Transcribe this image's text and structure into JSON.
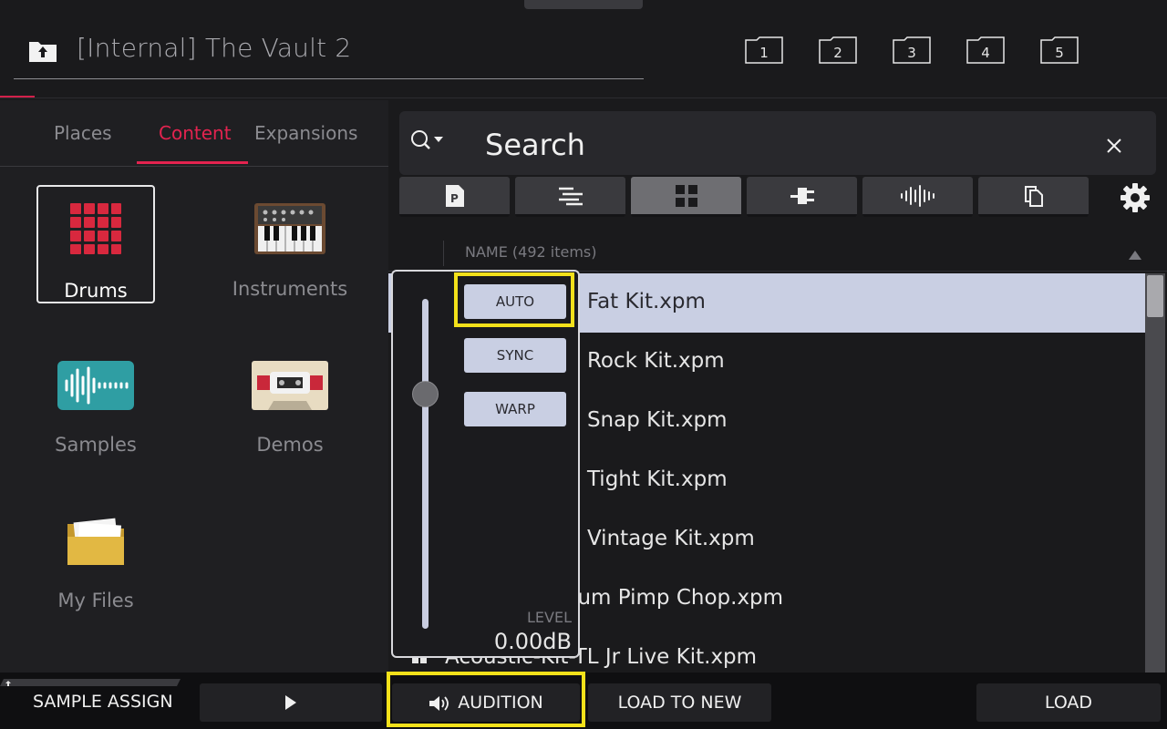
{
  "header": {
    "path_title": "[Internal] The Vault 2",
    "quick_folders": [
      "1",
      "2",
      "3",
      "4",
      "5"
    ]
  },
  "sidebar": {
    "tabs": [
      {
        "label": "Places",
        "active": false
      },
      {
        "label": "Content",
        "active": true
      },
      {
        "label": "Expansions",
        "active": false
      }
    ],
    "items": [
      {
        "label": "Drums",
        "icon": "drum-pads-icon",
        "selected": true
      },
      {
        "label": "Instruments",
        "icon": "synth-keyboard-icon",
        "selected": false
      },
      {
        "label": "Samples",
        "icon": "waveform-icon",
        "selected": false
      },
      {
        "label": "Demos",
        "icon": "cassette-icon",
        "selected": false
      },
      {
        "label": "My Files",
        "icon": "folder-icon",
        "selected": false
      }
    ]
  },
  "search": {
    "placeholder": "Search",
    "value": "Search"
  },
  "filters": [
    {
      "name": "program-filter-icon",
      "active": false
    },
    {
      "name": "sequence-filter-icon",
      "active": false
    },
    {
      "name": "kit-grid-filter-icon",
      "active": true
    },
    {
      "name": "plugin-filter-icon",
      "active": false
    },
    {
      "name": "sample-filter-icon",
      "active": false
    },
    {
      "name": "project-filter-icon",
      "active": false
    }
  ],
  "list": {
    "header": "NAME (492 items)",
    "rows": [
      {
        "label": "c Fat Kit.xpm",
        "selected": true
      },
      {
        "label": "c Rock Kit.xpm",
        "selected": false
      },
      {
        "label": "c Snap Kit.xpm",
        "selected": false
      },
      {
        "label": "c Tight Kit.xpm",
        "selected": false
      },
      {
        "label": "c Vintage Kit.xpm",
        "selected": false
      },
      {
        "label": "rum Pimp Chop.xpm",
        "selected": false
      },
      {
        "label": "Acoustic-Kit-TL Jr Live Kit.xpm",
        "selected": false
      }
    ]
  },
  "level_popup": {
    "buttons": [
      "AUTO",
      "SYNC",
      "WARP"
    ],
    "level_label": "LEVEL",
    "level_value": "0.00dB"
  },
  "bottom": {
    "sample_assign": "SAMPLE ASSIGN",
    "audition": "AUDITION",
    "load_new_track": "LOAD TO NEW TRACK",
    "load": "LOAD"
  },
  "colors": {
    "accent_red": "#e3234f",
    "highlight_yellow": "#f3e11a",
    "selection": "#c9cfe3"
  }
}
